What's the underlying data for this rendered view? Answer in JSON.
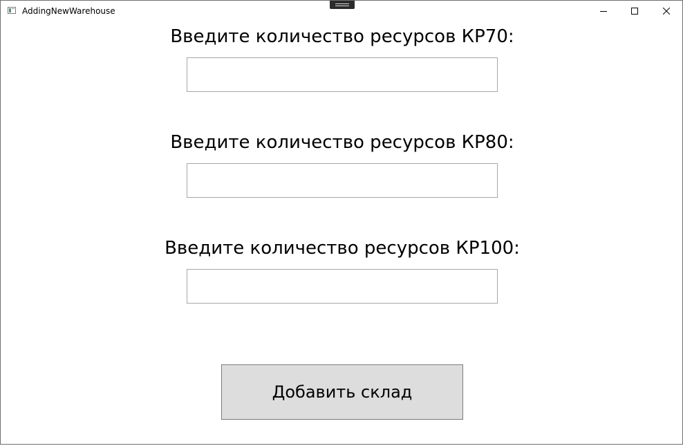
{
  "window": {
    "title": "AddingNewWarehouse",
    "app_icon": "window-app-icon",
    "controls": {
      "minimize_icon": "minimize-icon",
      "maximize_icon": "maximize-icon",
      "close_icon": "close-icon"
    }
  },
  "form": {
    "fields": [
      {
        "label": "Введите количество ресурсов КР70:",
        "value": ""
      },
      {
        "label": "Введите количество ресурсов КР80:",
        "value": ""
      },
      {
        "label": "Введите количество ресурсов КР100:",
        "value": ""
      }
    ],
    "submit_label": "Добавить склад"
  },
  "colors": {
    "button_background": "#dddddd",
    "input_border": "#a6a6a6",
    "window_border": "#6e6e6e"
  }
}
